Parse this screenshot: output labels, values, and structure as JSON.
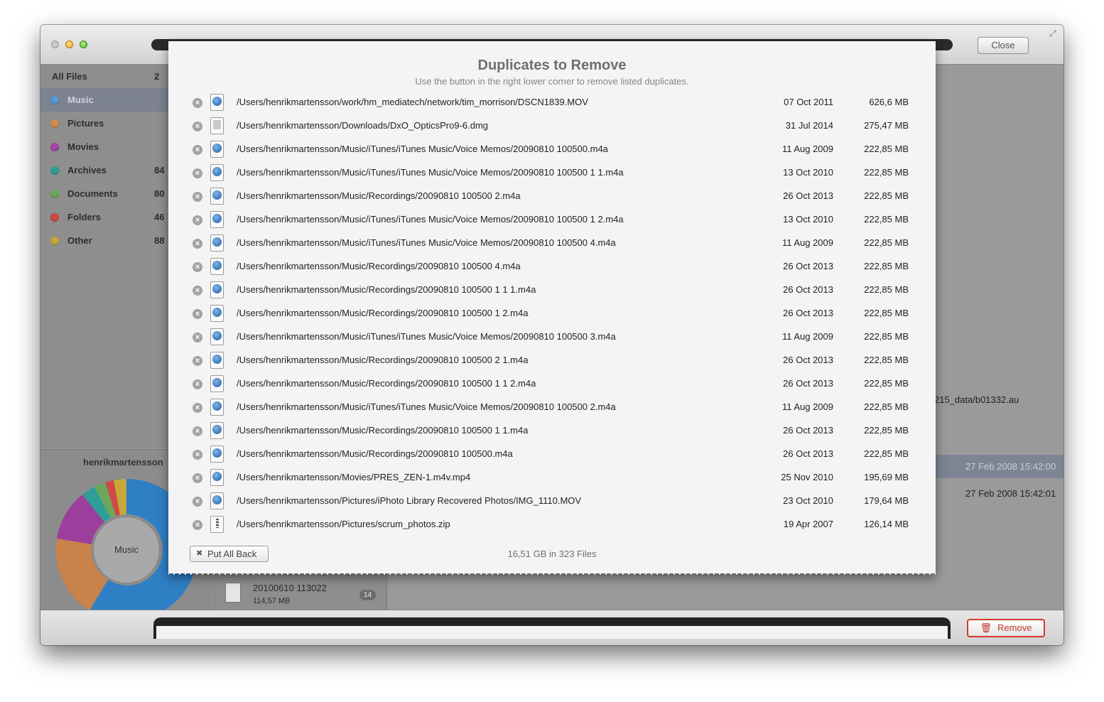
{
  "window": {
    "close_label": "Close"
  },
  "sidebar": {
    "items": [
      {
        "label": "All Files",
        "count": "2",
        "color": ""
      },
      {
        "label": "Music",
        "count": "",
        "color": "#5b9ad6"
      },
      {
        "label": "Pictures",
        "count": "",
        "color": "#d08e4e"
      },
      {
        "label": "Movies",
        "count": "",
        "color": "#a445a4"
      },
      {
        "label": "Archives",
        "count": "84",
        "color": "#2f9e98"
      },
      {
        "label": "Documents",
        "count": "80",
        "color": "#6da85a"
      },
      {
        "label": "Folders",
        "count": "46",
        "color": "#cf4a45"
      },
      {
        "label": "Other",
        "count": "88",
        "color": "#c8a83a"
      }
    ],
    "selected": "Music"
  },
  "stats": {
    "user": "henrikmartensson",
    "center_label": "Music"
  },
  "background": {
    "path_fragment": "215_data/b01332.au",
    "row_date_1": "27 Feb 2008 15:42:00",
    "row_date_2": "27 Feb 2008 15:42:01",
    "thumb_name": "20100610 113022",
    "thumb_size": "114,57 MB",
    "thumb_badge": "14"
  },
  "sheet": {
    "title": "Duplicates to Remove",
    "subtitle": "Use the button in the right lower corner to remove listed duplicates.",
    "put_back_label": "Put All Back",
    "summary": "16,51 GB in 323 Files",
    "rows": [
      {
        "icon": "mov",
        "path": "/Users/henrikmartensson/work/hm_mediatech/network/tim_morrison/DSCN1839.MOV",
        "date": "07 Oct 2011",
        "size": "626,6 MB"
      },
      {
        "icon": "dmg",
        "path": "/Users/henrikmartensson/Downloads/DxO_OpticsPro9-6.dmg",
        "date": "31 Jul 2014",
        "size": "275,47 MB"
      },
      {
        "icon": "m4a",
        "path": "/Users/henrikmartensson/Music/iTunes/iTunes Music/Voice Memos/20090810 100500.m4a",
        "date": "11 Aug 2009",
        "size": "222,85 MB"
      },
      {
        "icon": "m4a",
        "path": "/Users/henrikmartensson/Music/iTunes/iTunes Music/Voice Memos/20090810 100500 1 1.m4a",
        "date": "13 Oct 2010",
        "size": "222,85 MB"
      },
      {
        "icon": "m4a",
        "path": "/Users/henrikmartensson/Music/Recordings/20090810 100500 2.m4a",
        "date": "26 Oct 2013",
        "size": "222,85 MB"
      },
      {
        "icon": "m4a",
        "path": "/Users/henrikmartensson/Music/iTunes/iTunes Music/Voice Memos/20090810 100500 1 2.m4a",
        "date": "13 Oct 2010",
        "size": "222,85 MB"
      },
      {
        "icon": "m4a",
        "path": "/Users/henrikmartensson/Music/iTunes/iTunes Music/Voice Memos/20090810 100500 4.m4a",
        "date": "11 Aug 2009",
        "size": "222,85 MB"
      },
      {
        "icon": "m4a",
        "path": "/Users/henrikmartensson/Music/Recordings/20090810 100500 4.m4a",
        "date": "26 Oct 2013",
        "size": "222,85 MB"
      },
      {
        "icon": "m4a",
        "path": "/Users/henrikmartensson/Music/Recordings/20090810 100500 1 1 1.m4a",
        "date": "26 Oct 2013",
        "size": "222,85 MB"
      },
      {
        "icon": "m4a",
        "path": "/Users/henrikmartensson/Music/Recordings/20090810 100500 1 2.m4a",
        "date": "26 Oct 2013",
        "size": "222,85 MB"
      },
      {
        "icon": "m4a",
        "path": "/Users/henrikmartensson/Music/iTunes/iTunes Music/Voice Memos/20090810 100500 3.m4a",
        "date": "11 Aug 2009",
        "size": "222,85 MB"
      },
      {
        "icon": "m4a",
        "path": "/Users/henrikmartensson/Music/Recordings/20090810 100500 2 1.m4a",
        "date": "26 Oct 2013",
        "size": "222,85 MB"
      },
      {
        "icon": "m4a",
        "path": "/Users/henrikmartensson/Music/Recordings/20090810 100500 1 1 2.m4a",
        "date": "26 Oct 2013",
        "size": "222,85 MB"
      },
      {
        "icon": "m4a",
        "path": "/Users/henrikmartensson/Music/iTunes/iTunes Music/Voice Memos/20090810 100500 2.m4a",
        "date": "11 Aug 2009",
        "size": "222,85 MB"
      },
      {
        "icon": "m4a",
        "path": "/Users/henrikmartensson/Music/Recordings/20090810 100500 1 1.m4a",
        "date": "26 Oct 2013",
        "size": "222,85 MB"
      },
      {
        "icon": "m4a",
        "path": "/Users/henrikmartensson/Music/Recordings/20090810 100500.m4a",
        "date": "26 Oct 2013",
        "size": "222,85 MB"
      },
      {
        "icon": "mp4",
        "path": "/Users/henrikmartensson/Movies/PRES_ZEN-1.m4v.mp4",
        "date": "25 Nov 2010",
        "size": "195,69 MB"
      },
      {
        "icon": "mov",
        "path": "/Users/henrikmartensson/Pictures/iPhoto Library Recovered Photos/IMG_1110.MOV",
        "date": "23 Oct 2010",
        "size": "179,64 MB"
      },
      {
        "icon": "zip",
        "path": "/Users/henrikmartensson/Pictures/scrum_photos.zip",
        "date": "19 Apr 2007",
        "size": "126,14 MB"
      }
    ]
  },
  "bottom": {
    "remove_label": "Remove"
  },
  "colors": {
    "remove_accent": "#d23a2e",
    "selection": "#7e8393"
  }
}
